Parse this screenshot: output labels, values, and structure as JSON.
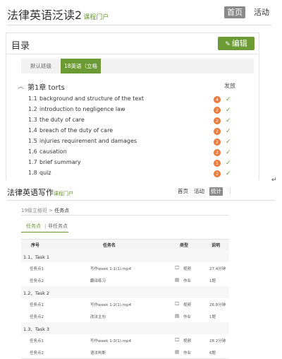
{
  "top": {
    "title": "法律英语泛读2",
    "portal": "课程门户",
    "nav": {
      "home": "首页",
      "activity": "活动"
    },
    "toc_label": "目录",
    "edit_label": "编辑",
    "tabs": [
      {
        "label": "默认班级",
        "active": false
      },
      {
        "label": "18英语（立格",
        "active": true
      }
    ],
    "chapter": {
      "title": "第1章 torts",
      "publish_header": "发放"
    },
    "sections": [
      {
        "num": "1.1",
        "title": "background and structure of the text",
        "count": "4"
      },
      {
        "num": "1.2",
        "title": "introduction to negligence law",
        "count": "2"
      },
      {
        "num": "1.3",
        "title": "the duty of care",
        "count": "2"
      },
      {
        "num": "1.4",
        "title": "breach of the duty of care",
        "count": "2"
      },
      {
        "num": "1.5",
        "title": "injuries requirement and damages",
        "count": "2"
      },
      {
        "num": "1.6",
        "title": "causation",
        "count": "2"
      },
      {
        "num": "1.7",
        "title": "brief summary",
        "count": "1"
      },
      {
        "num": "1.8",
        "title": "quiz",
        "count": "2"
      }
    ],
    "return_mark": "↵"
  },
  "bottom": {
    "title": "法律英语写作",
    "portal": "课程门户",
    "nav": {
      "home": "首页",
      "activity": "活动",
      "stats": "统计",
      "more": "⋮"
    },
    "breadcrumb": {
      "parent": "19级立格班",
      "sep": ">",
      "current": "任务点"
    },
    "subtabs": {
      "a": "任务点",
      "sep": "|",
      "b": "非任务点"
    },
    "headers": {
      "seq": "序号",
      "name": "任务名",
      "type": "类型",
      "desc": "说明"
    },
    "groups": [
      {
        "label": "1.1、Task 1",
        "rows": [
          {
            "seq": "任务点1",
            "name": "写作week 1-1(1).mp4",
            "type": "视频",
            "desc": "27.4分钟"
          },
          {
            "seq": "任务点2",
            "name": "翻译练习",
            "type": "作业",
            "desc": "1题"
          }
        ]
      },
      {
        "label": "1.2、Task 2",
        "rows": [
          {
            "seq": "任务点1",
            "name": "写作week 1-2(1).mp4",
            "type": "视频",
            "desc": "26.8分钟"
          },
          {
            "seq": "任务点2",
            "name": "改法主句",
            "type": "作业",
            "desc": "1题"
          }
        ]
      },
      {
        "label": "1.3、Task 3",
        "rows": [
          {
            "seq": "任务点1",
            "name": "写作week 1-3(1).mp4",
            "type": "视频",
            "desc": "28.2分钟"
          },
          {
            "seq": "任务点2",
            "name": "语法判断",
            "type": "作业",
            "desc": "6题"
          }
        ]
      }
    ]
  },
  "colors": {
    "accent": "#6c9b35",
    "badge": "#ee7a3a",
    "nav_active": "#8a8a8a"
  }
}
